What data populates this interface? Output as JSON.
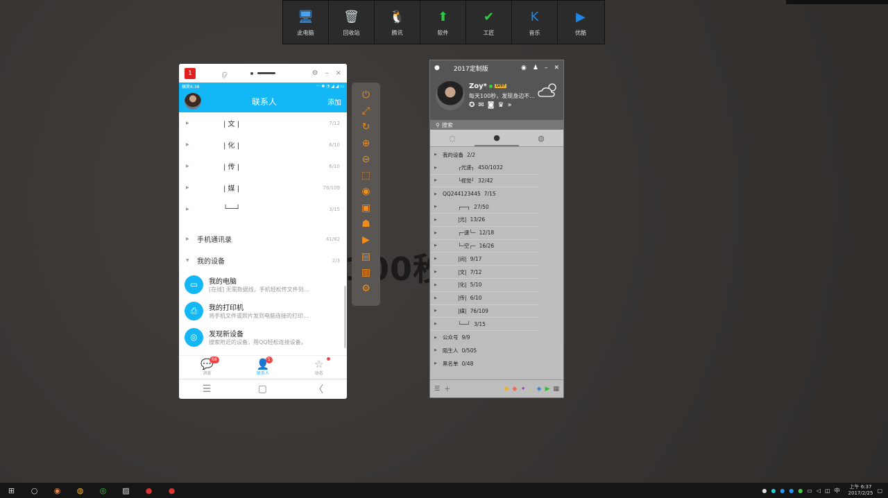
{
  "desktop": {
    "bg_text": "100秒"
  },
  "dock": [
    {
      "label": "此电脑",
      "icon": "computer-icon",
      "color": "#4aa3f0"
    },
    {
      "label": "回收站",
      "icon": "recycle-bin-icon",
      "color": "#cfd8dc"
    },
    {
      "label": "腾讯",
      "icon": "qq-penguin-icon",
      "color": "#222222"
    },
    {
      "label": "软件",
      "icon": "green-arrow-icon",
      "color": "#2ecc40"
    },
    {
      "label": "工匠",
      "icon": "checkmark-icon",
      "color": "#2ecc40"
    },
    {
      "label": "音乐",
      "icon": "kugou-icon",
      "color": "#1e88e5"
    },
    {
      "label": "优酷",
      "icon": "youku-icon",
      "color": "#1e88e5"
    }
  ],
  "phone": {
    "badge": "1",
    "status_left": "搞笑6:38",
    "header_title": "联系人",
    "header_add": "添加",
    "groups": [
      {
        "name": "| 文 |",
        "count": "7/12"
      },
      {
        "name": "| 化 |",
        "count": "6/10"
      },
      {
        "name": "| 传 |",
        "count": "6/10"
      },
      {
        "name": "| 媒 |",
        "count": "76/109"
      },
      {
        "name": "└──┘",
        "count": "3/15"
      }
    ],
    "contacts_group": {
      "name": "手机通讯录",
      "count": "41/82"
    },
    "devices_group": {
      "name": "我的设备",
      "count": "2/3"
    },
    "devices": [
      {
        "title": "我的电脑",
        "sub": "[在线] 无需数据线，手机轻松传文件到..."
      },
      {
        "title": "我的打印机",
        "sub": "将手机文件或照片发到电脑连接的打印..."
      },
      {
        "title": "发现新设备",
        "sub": "搜索附近的设备，用QQ轻松连接设备。"
      }
    ],
    "tabs": [
      {
        "label": "消息",
        "badge": "68"
      },
      {
        "label": "联系人",
        "badge": "5"
      },
      {
        "label": "动态",
        "badge": ""
      }
    ]
  },
  "toolbar": [
    "power-icon",
    "fullscreen-icon",
    "rotate-icon",
    "zoom-in-icon",
    "zoom-out-icon",
    "crop-icon",
    "record-icon",
    "folder-icon",
    "android-icon",
    "gif-icon",
    "gif2-icon",
    "file-icon",
    "user-settings-icon"
  ],
  "qq": {
    "title": "2017定制版",
    "nick": "Zoy*",
    "level": "LV97",
    "signature": "每天100秒，发现身边不...",
    "search_placeholder": "搜索",
    "groups": [
      {
        "name": "我的设备",
        "count": "2/2",
        "sub": false
      },
      {
        "name": "┌光速┐",
        "count": "450/1032",
        "sub": true
      },
      {
        "name": "└视觉┘",
        "count": "32/42",
        "sub": true
      },
      {
        "name": "QQ244123445",
        "count": "7/15",
        "sub": false
      },
      {
        "name": "┌──┐",
        "count": "27/50",
        "sub": true
      },
      {
        "name": "|光|",
        "count": "13/26",
        "sub": true
      },
      {
        "name": "┌─速└─",
        "count": "12/18",
        "sub": true
      },
      {
        "name": "└─空┌─",
        "count": "16/26",
        "sub": true
      },
      {
        "name": "|间|",
        "count": "9/17",
        "sub": true
      },
      {
        "name": "|文|",
        "count": "7/12",
        "sub": true
      },
      {
        "name": "|化|",
        "count": "5/10",
        "sub": true
      },
      {
        "name": "|传|",
        "count": "6/10",
        "sub": true
      },
      {
        "name": "|媒|",
        "count": "76/109",
        "sub": true
      },
      {
        "name": "└──┘",
        "count": "3/15",
        "sub": true
      },
      {
        "name": "公众号",
        "count": "9/9",
        "sub": false
      },
      {
        "name": "陌生人",
        "count": "0/505",
        "sub": false
      },
      {
        "name": "黑名单",
        "count": "0/48",
        "sub": false
      }
    ]
  },
  "taskbar": {
    "time": "上午 6:37",
    "date": "2017/2/25",
    "ime": "中"
  }
}
